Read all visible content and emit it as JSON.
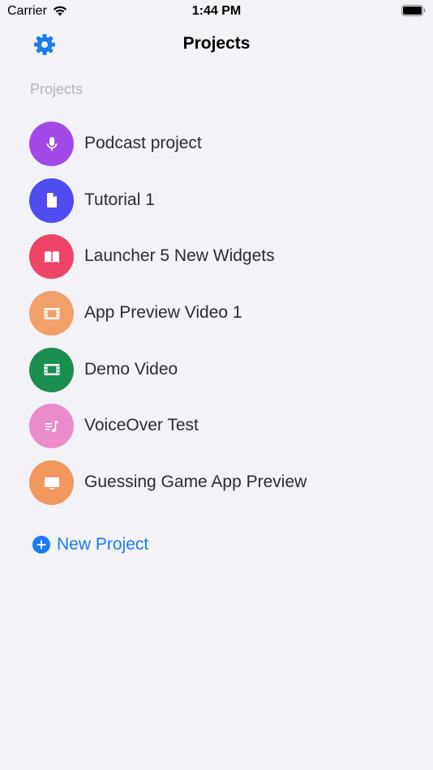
{
  "status_bar": {
    "carrier": "Carrier",
    "time": "1:44 PM"
  },
  "nav": {
    "title": "Projects",
    "settings_icon": "gear-icon",
    "accent_color": "#1a7cf0"
  },
  "section": {
    "header": "Projects"
  },
  "projects": [
    {
      "name": "Podcast project",
      "icon": "microphone-icon",
      "color": "#a24ae8"
    },
    {
      "name": "Tutorial 1",
      "icon": "document-icon",
      "color": "#4f4df0"
    },
    {
      "name": "Launcher 5 New Widgets",
      "icon": "book-icon",
      "color": "#ee4566"
    },
    {
      "name": "App Preview Video 1",
      "icon": "film-icon",
      "color": "#f2a06a"
    },
    {
      "name": "Demo Video",
      "icon": "film-icon",
      "color": "#1a8f50"
    },
    {
      "name": "VoiceOver Test",
      "icon": "music-list-icon",
      "color": "#ea8ccc"
    },
    {
      "name": "Guessing Game App Preview",
      "icon": "display-icon",
      "color": "#f2975e"
    }
  ],
  "new_project": {
    "label": "New Project",
    "icon": "plus-circle-icon"
  }
}
